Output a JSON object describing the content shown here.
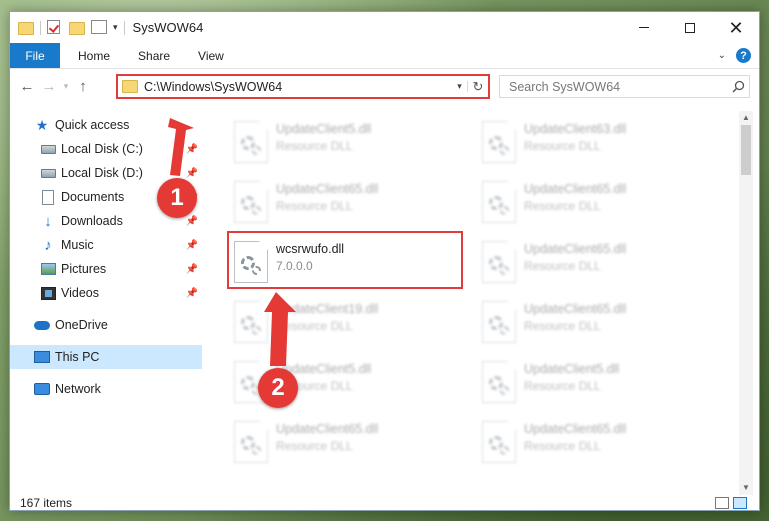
{
  "window": {
    "title": "SysWOW64",
    "controls": {
      "minimize": "—",
      "maximize": "☐",
      "close": "✕"
    }
  },
  "ribbon": {
    "tabs": [
      "File",
      "Home",
      "Share",
      "View"
    ],
    "help_label": "?"
  },
  "address_bar": {
    "path": "C:\\Windows\\SysWOW64",
    "search_placeholder": "Search SysWOW64"
  },
  "nav_pane": {
    "items": [
      {
        "label": "Quick access",
        "icon": "star-icon",
        "level": "top"
      },
      {
        "label": "Local Disk (C:)",
        "icon": "drive-icon",
        "level": "sub",
        "pinned": true
      },
      {
        "label": "Local Disk (D:)",
        "icon": "drive-icon",
        "level": "sub",
        "pinned": true
      },
      {
        "label": "Documents",
        "icon": "documents-icon",
        "level": "sub",
        "pinned": true
      },
      {
        "label": "Downloads",
        "icon": "downloads-icon",
        "level": "sub",
        "pinned": true
      },
      {
        "label": "Music",
        "icon": "music-icon",
        "level": "sub",
        "pinned": true
      },
      {
        "label": "Pictures",
        "icon": "pictures-icon",
        "level": "sub",
        "pinned": true
      },
      {
        "label": "Videos",
        "icon": "videos-icon",
        "level": "sub",
        "pinned": true
      },
      {
        "label": "OneDrive",
        "icon": "onedrive-icon",
        "level": "top"
      },
      {
        "label": "This PC",
        "icon": "this-pc-icon",
        "level": "top",
        "selected": true
      },
      {
        "label": "Network",
        "icon": "network-icon",
        "level": "top"
      }
    ]
  },
  "files": [
    {
      "name": "UpdateClient5.dll",
      "desc": "Resource DLL",
      "blurred": true
    },
    {
      "name": "UpdateClient63.dll",
      "desc": "Resource DLL",
      "blurred": true
    },
    {
      "name": "UpdateClient65.dll",
      "desc": "Resource DLL",
      "blurred": true
    },
    {
      "name": "UpdateClient65.dll",
      "desc": "Resource DLL",
      "blurred": true
    },
    {
      "name": "wcsrwufo.dll",
      "desc": "7.0.0.0",
      "blurred": false
    },
    {
      "name": "UpdateClient65.dll",
      "desc": "Resource DLL",
      "blurred": true
    },
    {
      "name": "UpdateClient19.dll",
      "desc": "Resource DLL",
      "blurred": true
    },
    {
      "name": "UpdateClient65.dll",
      "desc": "Resource DLL",
      "blurred": true
    },
    {
      "name": "UpdateClient5.dll",
      "desc": "Resource DLL",
      "blurred": true
    },
    {
      "name": "UpdateClient5.dll",
      "desc": "Resource DLL",
      "blurred": true
    },
    {
      "name": "UpdateClient65.dll",
      "desc": "Resource DLL",
      "blurred": true
    },
    {
      "name": "UpdateClient65.dll",
      "desc": "Resource DLL",
      "blurred": true
    }
  ],
  "status_bar": {
    "item_count": "167 items"
  },
  "annotations": {
    "step1": "1",
    "step2": "2",
    "color": "#e53935"
  }
}
